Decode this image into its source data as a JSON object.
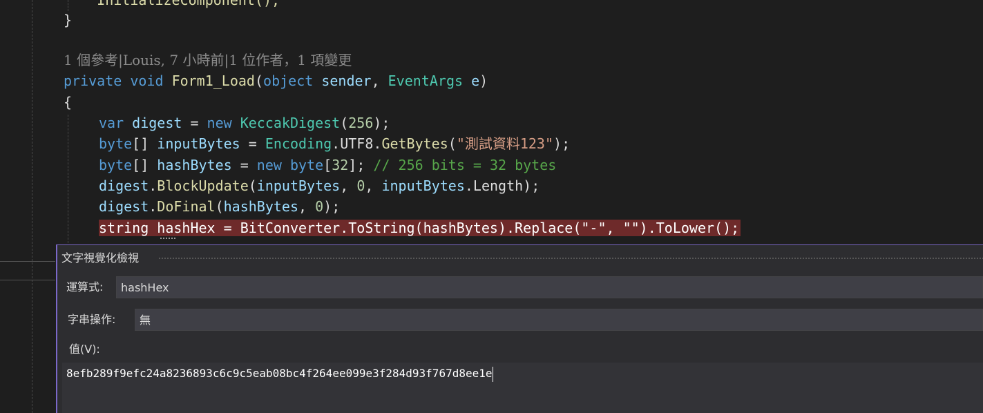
{
  "editor": {
    "line_top": "    InitializeComponent();",
    "close_brace": "}",
    "codelens": "1 個參考|Louis, 7 小時前|1 位作者，1 項變更",
    "sig": {
      "kw_private": "private",
      "kw_void": "void",
      "method": "Form1_Load",
      "open": "(",
      "kw_object": "object",
      "p_sender": "sender",
      "comma": ",",
      "t_eventargs": "EventArgs",
      "p_e": "e",
      "close": ")"
    },
    "open_brace": "{",
    "l1": {
      "kw": "var",
      "id": "digest",
      "eq": " = ",
      "kw_new": "new",
      "ty": "KeccakDigest",
      "a": "(",
      "num": "256",
      "b": ");"
    },
    "l2": {
      "kw": "byte",
      "br": "[] ",
      "id": "inputBytes",
      "eq": " = ",
      "ty": "Encoding",
      "dot": ".",
      "p": "UTF8.",
      "fn": "GetBytes",
      "a": "(",
      "str": "\"測試資料123\"",
      "b": ");"
    },
    "l3": {
      "kw": "byte",
      "br": "[] ",
      "id": "hashBytes",
      "eq": " = ",
      "kw_new": "new",
      "sp": " ",
      "kw2": "byte",
      "a": "[",
      "num": "32",
      "b": "]; ",
      "cm": "// 256 bits = 32 bytes"
    },
    "l4": {
      "id": "digest",
      "dot": ".",
      "fn": "BlockUpdate",
      "a": "(",
      "id2": "inputBytes",
      "c1": ", ",
      "num": "0",
      "c2": ", ",
      "id3": "inputBytes",
      "p": ".Length);"
    },
    "l5": {
      "id": "digest",
      "dot": ".",
      "fn": "DoFinal",
      "a": "(",
      "id2": "hashBytes",
      "c1": ", ",
      "num": "0",
      "b": ");"
    },
    "l6": "string hashHex = BitConverter.ToString(hashBytes).Replace(\"-\", \"\").ToLower();"
  },
  "dialog": {
    "title": "文字視覺化檢視",
    "expression_label": "運算式:",
    "expression_value": "hashHex",
    "string_op_label": "字串操作:",
    "string_op_value": "無",
    "value_label": "值(V):",
    "value": "8efb289f9efc24a8236893c6c9c5eab08bc4f264ee099e3f284d93f767d8ee1e"
  }
}
